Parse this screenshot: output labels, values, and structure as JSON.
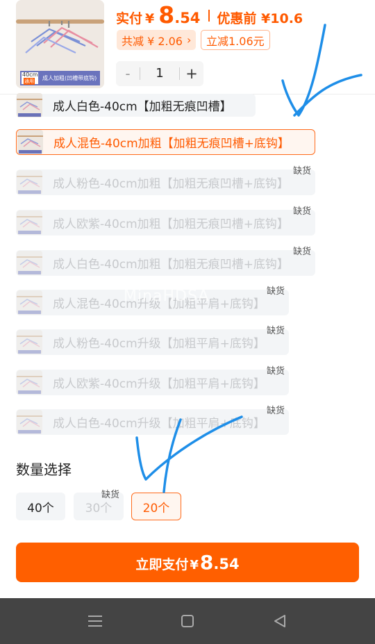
{
  "header": {
    "price_label": "实付",
    "currency": "¥",
    "price_int": "8",
    "price_dec": ".54",
    "before_discount": "优惠前 ¥10.6",
    "total_discount": "共减 ¥ 2.06",
    "total_discount_chevron": "›",
    "instant_discount": "立减1.06元",
    "thumb_size": "40cm",
    "thumb_tag": "通用",
    "thumb_caption": "成人加粗(凹槽带底钩)",
    "quantity": {
      "minus": "-",
      "value": "1",
      "plus": "+"
    }
  },
  "options": [
    {
      "label": "成人白色-40cm【加粗无痕凹槽】",
      "state": "normal",
      "badge": ""
    },
    {
      "label": "成人混色-40cm加粗【加粗无痕凹槽+底钩】",
      "state": "selected",
      "badge": ""
    },
    {
      "label": "成人粉色-40cm加粗【加粗无痕凹槽+底钩】",
      "state": "disabled",
      "badge": "缺货"
    },
    {
      "label": "成人欧紫-40cm加粗【加粗无痕凹槽+底钩】",
      "state": "disabled",
      "badge": "缺货"
    },
    {
      "label": "成人白色-40cm加粗【加粗无痕凹槽+底钩】",
      "state": "disabled",
      "badge": "缺货"
    },
    {
      "label": "成人混色-40cm升级【加粗平肩+底钩】",
      "state": "disabled",
      "badge": "缺货"
    },
    {
      "label": "成人粉色-40cm升级【加粗平肩+底钩】",
      "state": "disabled",
      "badge": "缺货"
    },
    {
      "label": "成人欧紫-40cm升级【加粗平肩+底钩】",
      "state": "disabled",
      "badge": "缺货"
    },
    {
      "label": "成人白色-40cm升级【加粗平肩+底钩】",
      "state": "disabled",
      "badge": "缺货"
    }
  ],
  "quantity_section": {
    "title": "数量选择",
    "choices": [
      {
        "label": "40个",
        "state": "normal",
        "badge": ""
      },
      {
        "label": "30个",
        "state": "disabled",
        "badge": "缺货"
      },
      {
        "label": "20个",
        "state": "selected",
        "badge": ""
      }
    ]
  },
  "pay_button": {
    "text": "立即支付",
    "currency": "¥",
    "int": "8",
    "dec": ".54"
  },
  "watermark": "MinaHDSA",
  "nav": {
    "menu_icon": "menu-icon",
    "home_icon": "home-icon",
    "back_icon": "back-icon"
  },
  "colors": {
    "accent": "#ff5f00",
    "accent_soft": "#fff6f0",
    "disabled_text": "#c7c9cc",
    "annotation": "#1e8ee8",
    "navbar": "#444444"
  }
}
